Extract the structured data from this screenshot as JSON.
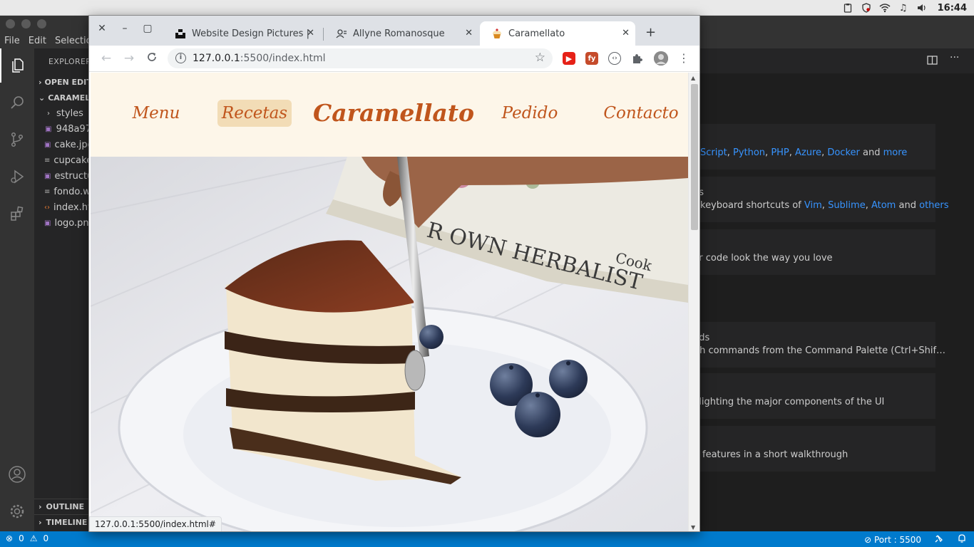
{
  "system": {
    "clock": "16:44"
  },
  "vscode": {
    "menu": [
      "File",
      "Edit",
      "Selection"
    ],
    "explorer_label": "EXPLORER",
    "open_editors": "OPEN EDITORS",
    "project": "CARAMELLATO",
    "files": [
      {
        "name": "styles",
        "icon": "folder"
      },
      {
        "name": "948a97",
        "icon": "image"
      },
      {
        "name": "cake.jpg",
        "icon": "image"
      },
      {
        "name": "cupcake",
        "icon": "text"
      },
      {
        "name": "estructura",
        "icon": "image"
      },
      {
        "name": "fondo.webp",
        "icon": "text"
      },
      {
        "name": "index.html",
        "icon": "html"
      },
      {
        "name": "logo.png",
        "icon": "image"
      }
    ],
    "outline": "OUTLINE",
    "timeline": "TIMELINE",
    "walkthrough": [
      {
        "pre": "",
        "links": [
          "Script",
          "Python",
          "PHP",
          "Azure",
          "Docker"
        ],
        "and": "and",
        "more": "more",
        "text2": ""
      },
      {
        "text": "gs",
        "text2": "keyboard shortcuts of",
        "links": [
          "Vim",
          "Sublime",
          "Atom"
        ],
        "and": "and",
        "more": "others"
      },
      {
        "text": "ur code look the way you love"
      },
      {
        "text": "nds",
        "text2": "ch commands from the Command Palette (Ctrl+Shif…"
      },
      {
        "text": "nlighting the major components of the UI"
      },
      {
        "text": "features in a short walkthrough"
      }
    ],
    "status": {
      "errors": "0",
      "warnings": "0",
      "port": "Port : 5500"
    }
  },
  "chrome": {
    "tabs": [
      {
        "title": "Website Design Pictures | D",
        "icon": "unsplash-icon"
      },
      {
        "title": "Allyne Romanosque",
        "icon": "contact-icon"
      },
      {
        "title": "Caramellato",
        "icon": "cupcake-icon",
        "active": true
      }
    ],
    "url_host": "127.0.0.1",
    "url_path": ":5500/index.html",
    "status_url": "127.0.0.1:5500/index.html#"
  },
  "site": {
    "nav": [
      "Menu",
      "Recetas",
      "Pedido",
      "Contacto"
    ],
    "brand": "Caramellato",
    "active_nav": "Recetas",
    "colors": {
      "header_bg": "#fdf6e9",
      "accent": "#c0551c",
      "active_bg": "#f2dcb6"
    },
    "hero": {
      "book_text": "R OWN HERBALIST",
      "book_author": "Cook"
    }
  }
}
